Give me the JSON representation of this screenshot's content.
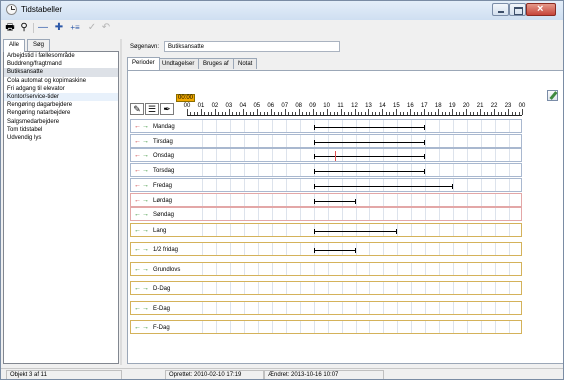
{
  "window": {
    "title": "Tidstabeller"
  },
  "toolbar": {
    "buttons": [
      {
        "name": "print-icon",
        "glyph": "🖶"
      },
      {
        "name": "binoculars-icon",
        "glyph": "⚲"
      },
      {
        "name": "remove-icon",
        "glyph": "—"
      },
      {
        "name": "add-icon",
        "glyph": "✚"
      },
      {
        "name": "add-list-icon",
        "glyph": "+≡"
      },
      {
        "name": "checkmark-icon",
        "glyph": "✓"
      },
      {
        "name": "undo-icon",
        "glyph": "↶"
      }
    ]
  },
  "left_tabs": [
    "Alle",
    "Søg"
  ],
  "list_items": [
    "Arbejdstid i fællesområde",
    "Buddreng/fragtmand",
    "Butiksansatte",
    "Cola automat og kopimaskine",
    "Fri adgang til elevator",
    "Kontor/service-tider",
    "Rengøring dagarbejdere",
    "Rengøring natarbejdere",
    "Salgsmedarbejdere",
    "Tom tidstabel",
    "Udvendig lys"
  ],
  "form": {
    "name_label": "Søgenavn:",
    "name_value": "Butiksansatte"
  },
  "right_tabs": [
    "Perioder",
    "Undtagelser",
    "Bruges af",
    "Notat"
  ],
  "hour_badge": "00:00",
  "hours": [
    "00",
    "01",
    "02",
    "03",
    "04",
    "05",
    "06",
    "07",
    "08",
    "09",
    "10",
    "11",
    "12",
    "13",
    "14",
    "15",
    "16",
    "17",
    "18",
    "19",
    "20",
    "21",
    "22",
    "23",
    "00"
  ],
  "days": [
    {
      "label": "Mandag",
      "left_arrow": "red",
      "period": [
        9,
        17
      ]
    },
    {
      "label": "Tirsdag",
      "left_arrow": "red",
      "period": [
        9,
        17
      ]
    },
    {
      "label": "Onsdag",
      "left_arrow": "red",
      "period": [
        9,
        17
      ]
    },
    {
      "label": "Torsdag",
      "left_arrow": "red",
      "period": [
        9,
        17
      ]
    },
    {
      "label": "Fredag",
      "left_arrow": "red",
      "period": [
        9,
        19
      ]
    },
    {
      "label": "Lørdag",
      "left_arrow": "red",
      "period": [
        9,
        12
      ]
    },
    {
      "label": "Søndag",
      "left_arrow": "green",
      "period": null
    }
  ],
  "special_days": [
    {
      "label": "Lang",
      "period": [
        9,
        15
      ]
    },
    {
      "label": "1/2 fridag",
      "period": [
        9,
        12
      ]
    },
    {
      "label": "Grundlovs",
      "period": null
    },
    {
      "label": "D-Dag",
      "period": null
    },
    {
      "label": "E-Dag",
      "period": null
    },
    {
      "label": "F-Dag",
      "period": null
    }
  ],
  "status": {
    "record": "Objekt 3 af 11",
    "created": "Oprettet: 2010-02-10 17:19",
    "modified": "Ændret: 2013-10-16 10:07"
  },
  "colors": {
    "weekday_border": "#a9b8cf",
    "weekend_border": "#e3a7a7",
    "special_border": "#d4b25a",
    "badge": "#f2a900"
  }
}
